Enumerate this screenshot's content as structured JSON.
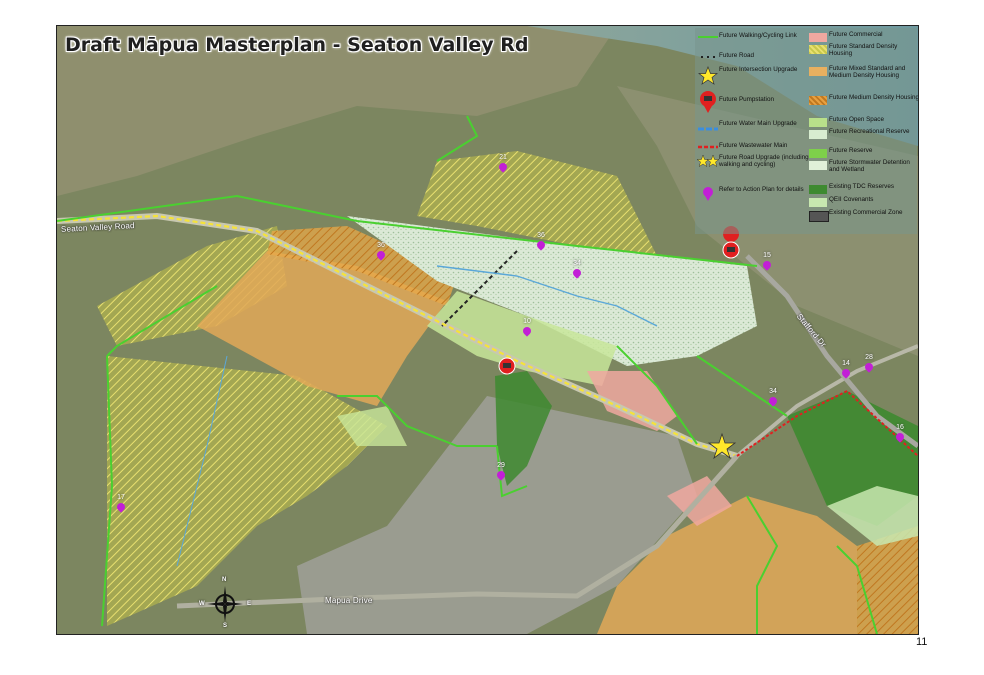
{
  "title": "Draft Māpua Masterplan - Seaton Valley Rd",
  "page_number": "11",
  "road_labels": {
    "seaton_valley": "Seaton Valley Road",
    "stafford": "Stafford Dr",
    "mapua_drive": "Mapua Drive"
  },
  "compass": {
    "n": "N",
    "s": "S",
    "e": "E",
    "w": "W"
  },
  "legend": {
    "col1": [
      {
        "id": "walk",
        "label": "Future Walking/Cycling Link"
      },
      {
        "id": "road",
        "label": "Future Road"
      },
      {
        "id": "intersection",
        "label": "Future Intersection Upgrade"
      },
      {
        "id": "pumpstation",
        "label": "Future Pumpstation"
      },
      {
        "id": "watermain",
        "label": "Future Water Main Upgrade"
      },
      {
        "id": "wastewater",
        "label": "Future Wastewater Main"
      },
      {
        "id": "roadupgrade",
        "label": "Future Road Upgrade (including walking and cycling)"
      },
      {
        "id": "actionplan",
        "label": "Refer to Action Plan for details"
      }
    ],
    "col2": [
      {
        "id": "commercial",
        "label": "Future Commercial",
        "color": "#f0a8a0"
      },
      {
        "id": "standard",
        "label": "Future Standard Density Housing",
        "color": "#c8c84a"
      },
      {
        "id": "mixed",
        "label": "Future Mixed Standard and Medium Density Housing",
        "color": "#e8b060"
      },
      {
        "id": "medium",
        "label": "Future Medium Density Housing",
        "color": "#e8a040"
      },
      {
        "id": "openspace",
        "label": "Future Open Space",
        "color": "#b8e08a"
      },
      {
        "id": "recreational",
        "label": "Future Recreational Reserve",
        "color": "#d8ecd0"
      },
      {
        "id": "reserve",
        "label": "Future Reserve",
        "color": "#7ed04a"
      },
      {
        "id": "stormwater",
        "label": "Future Stormwater Detention and Wetland",
        "color": "#e0f0d8"
      },
      {
        "id": "tdc",
        "label": "Existing TDC Reserves",
        "color": "#3e8a30"
      },
      {
        "id": "qeii",
        "label": "QEII Covenants",
        "color": "#c8e8b0"
      },
      {
        "id": "existcommercial",
        "label": "Existing Commercial Zone",
        "color": "#555555"
      }
    ]
  },
  "action_points": [
    {
      "label": "21"
    },
    {
      "label": "36"
    },
    {
      "label": "36"
    },
    {
      "label": "34"
    },
    {
      "label": "10"
    },
    {
      "label": "15"
    },
    {
      "label": "14"
    },
    {
      "label": "28"
    },
    {
      "label": "34"
    },
    {
      "label": "16"
    },
    {
      "label": "29"
    },
    {
      "label": "17"
    }
  ]
}
